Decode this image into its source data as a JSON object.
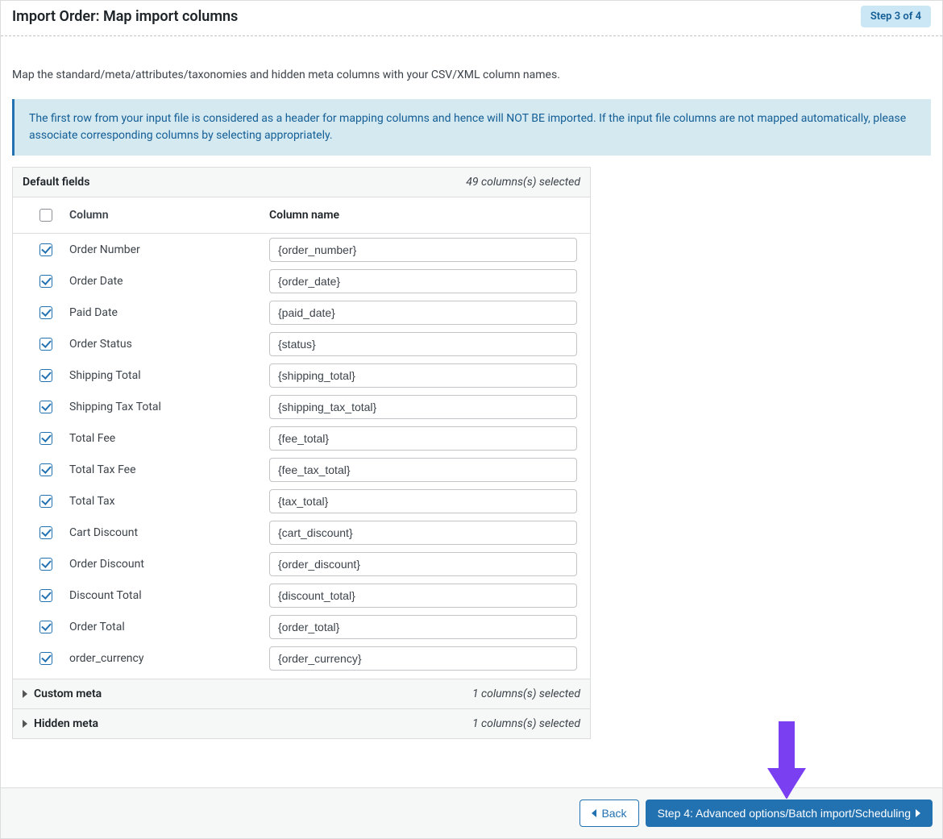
{
  "header": {
    "title": "Import Order: Map import columns",
    "step_badge": "Step 3 of 4"
  },
  "description": "Map the standard/meta/attributes/taxonomies and hidden meta columns with your CSV/XML column names.",
  "notice": "The first row from your input file is considered as a header for mapping columns and hence will NOT BE imported. If the input file columns are not mapped automatically, please associate corresponding columns by selecting appropriately.",
  "panel": {
    "default_fields": {
      "title": "Default fields",
      "count": "49 columns(s) selected",
      "thead": {
        "column": "Column",
        "column_name": "Column name"
      },
      "rows": [
        {
          "label": "Order Number",
          "value": "{order_number}"
        },
        {
          "label": "Order Date",
          "value": "{order_date}"
        },
        {
          "label": "Paid Date",
          "value": "{paid_date}"
        },
        {
          "label": "Order Status",
          "value": "{status}"
        },
        {
          "label": "Shipping Total",
          "value": "{shipping_total}"
        },
        {
          "label": "Shipping Tax Total",
          "value": "{shipping_tax_total}"
        },
        {
          "label": "Total Fee",
          "value": "{fee_total}"
        },
        {
          "label": "Total Tax Fee",
          "value": "{fee_tax_total}"
        },
        {
          "label": "Total Tax",
          "value": "{tax_total}"
        },
        {
          "label": "Cart Discount",
          "value": "{cart_discount}"
        },
        {
          "label": "Order Discount",
          "value": "{order_discount}"
        },
        {
          "label": "Discount Total",
          "value": "{discount_total}"
        },
        {
          "label": "Order Total",
          "value": "{order_total}"
        },
        {
          "label": "order_currency",
          "value": "{order_currency}"
        }
      ]
    },
    "custom_meta": {
      "title": "Custom meta",
      "count": "1 columns(s) selected"
    },
    "hidden_meta": {
      "title": "Hidden meta",
      "count": "1 columns(s) selected"
    }
  },
  "footer": {
    "back": "Back",
    "next": "Step 4: Advanced options/Batch import/Scheduling"
  }
}
